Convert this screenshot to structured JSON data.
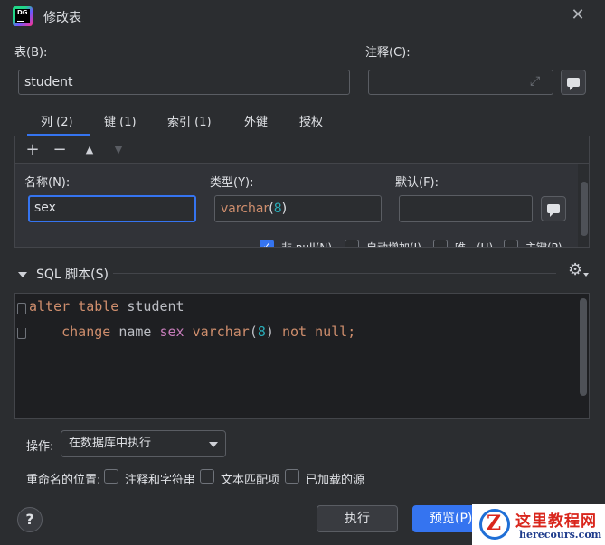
{
  "window": {
    "title": "修改表",
    "app_logo_text": "DG"
  },
  "table_field": {
    "label": "表(B):",
    "value": "student"
  },
  "comment_field": {
    "label": "注释(C):",
    "value": ""
  },
  "tabs": [
    {
      "label": "列 (2)"
    },
    {
      "label": "键 (1)"
    },
    {
      "label": "索引 (1)"
    },
    {
      "label": "外键"
    },
    {
      "label": "授权"
    }
  ],
  "toolbar": {
    "add": "+",
    "remove": "−",
    "up": "▲",
    "down": "▼"
  },
  "column_form": {
    "name_label": "名称(N):",
    "name_value": "sex",
    "type_label": "类型(Y):",
    "type_word": "varchar",
    "type_open": "(",
    "type_len": "8",
    "type_close": ")",
    "default_label": "默认(F):",
    "default_value": "",
    "checks": [
      {
        "label": "非 null(N)",
        "checked": true
      },
      {
        "label": "自动增加(I)",
        "checked": false
      },
      {
        "label": "唯一(U)",
        "checked": false
      },
      {
        "label": "主键(P)",
        "checked": false
      }
    ]
  },
  "sql_section": {
    "title": "SQL 脚本(S)",
    "line1": {
      "kw1": "alter",
      "kw2": "table",
      "id": "student"
    },
    "line2": {
      "kw1": "change",
      "id": "name",
      "col": "sex",
      "kw2": "varchar",
      "p1": "(",
      "num": "8",
      "p2": ")",
      "kw3": "not",
      "kw4": "null;"
    }
  },
  "operation": {
    "label": "操作:",
    "selected": "在数据库中执行"
  },
  "rename": {
    "label": "重命名的位置:",
    "options": [
      {
        "label": "注释和字符串",
        "checked": false
      },
      {
        "label": "文本匹配项",
        "checked": false
      },
      {
        "label": "已加载的源",
        "checked": false
      }
    ]
  },
  "buttons": {
    "help": "?",
    "execute": "执行",
    "preview": "预览(P)"
  },
  "watermark": {
    "text": "这里教程网",
    "url": "herecours.com",
    "logo_letter": "Z"
  },
  "colors": {
    "accent": "#3574f0",
    "background": "#2b2d30",
    "editor_bg": "#1e1f22",
    "keyword": "#cf8e6d",
    "column": "#c77dbb",
    "number": "#2aacb8"
  }
}
